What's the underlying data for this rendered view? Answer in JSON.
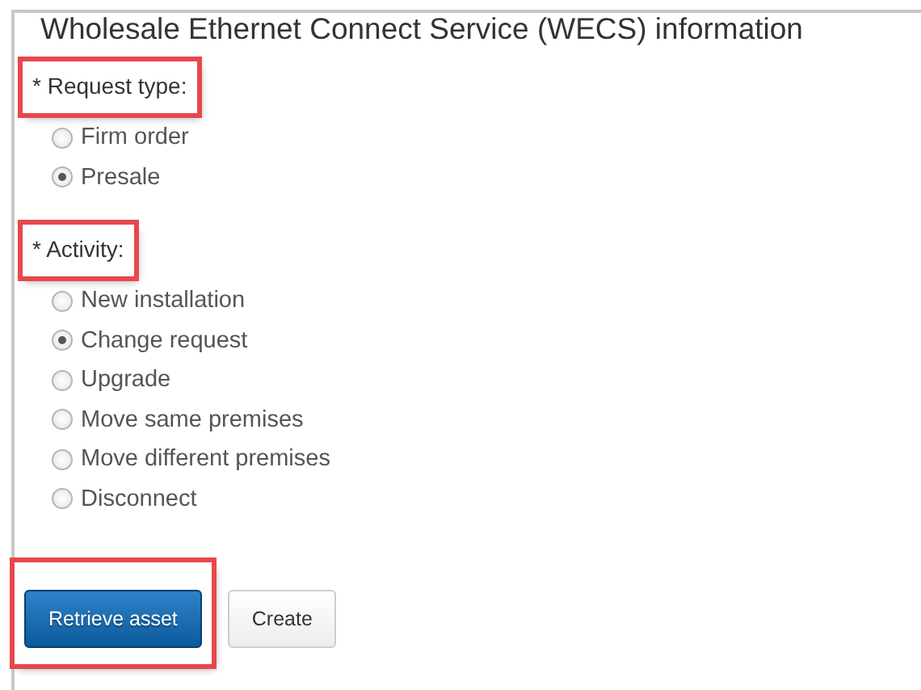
{
  "panel": {
    "title": "Wholesale Ethernet Connect Service (WECS) information"
  },
  "groups": [
    {
      "label": "* Request type:",
      "highlighted": true,
      "options": [
        {
          "label": "Firm order",
          "selected": false
        },
        {
          "label": "Presale",
          "selected": true
        }
      ]
    },
    {
      "label": "* Activity:",
      "highlighted": true,
      "options": [
        {
          "label": "New installation",
          "selected": false
        },
        {
          "label": "Change request",
          "selected": true
        },
        {
          "label": "Upgrade",
          "selected": false
        },
        {
          "label": "Move same premises",
          "selected": false
        },
        {
          "label": "Move different premises",
          "selected": false
        },
        {
          "label": "Disconnect",
          "selected": false
        }
      ]
    }
  ],
  "buttons": [
    {
      "label": "Retrieve asset",
      "kind": "primary",
      "highlighted": true
    },
    {
      "label": "Create",
      "kind": "default",
      "highlighted": false
    }
  ]
}
